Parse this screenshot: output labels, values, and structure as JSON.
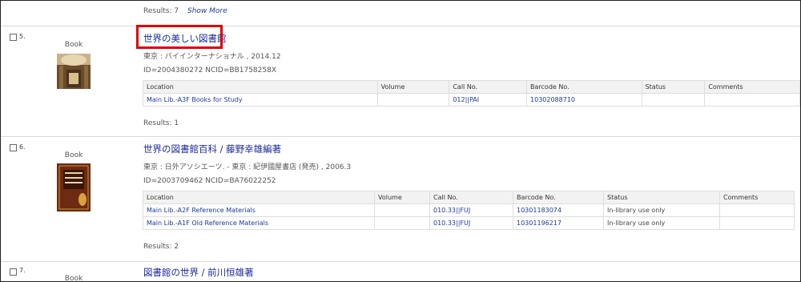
{
  "top": {
    "results": "Results: 7",
    "show_more": "Show More"
  },
  "records": [
    {
      "num": "5.",
      "type": "Book",
      "title": "世界の美しい図書館",
      "pub": "東京 : パイインターナショナル , 2014.12",
      "ids": "ID=2004380272 NCID=BB1758258X",
      "headers": [
        "Location",
        "Volume",
        "Call No.",
        "Barcode No.",
        "Status",
        "Comments"
      ],
      "rows": [
        {
          "location": "Main Lib.-A3F Books for Study",
          "volume": "",
          "call": "012||PAI",
          "barcode": "10302088710",
          "status": "",
          "comments": ""
        }
      ],
      "results": "Results: 1"
    },
    {
      "num": "6.",
      "type": "Book",
      "title": "世界の図書館百科 / 藤野幸雄編著",
      "pub": "東京 : 日外アソシエーツ. - 東京 : 紀伊國屋書店 (発売) , 2006.3",
      "ids": "ID=2003709462 NCID=BA76022252",
      "headers": [
        "Location",
        "Volume",
        "Call No.",
        "Barcode No.",
        "Status",
        "Comments"
      ],
      "rows": [
        {
          "location": "Main Lib.-A2F Reference Materials",
          "volume": "",
          "call": "010.33||FUJ",
          "barcode": "10301183074",
          "status": "In-library use only",
          "comments": ""
        },
        {
          "location": "Main Lib.-A1F Old Reference Materials",
          "volume": "",
          "call": "010.33||FUJ",
          "barcode": "10301196217",
          "status": "In-library use only",
          "comments": ""
        }
      ],
      "results": "Results: 2"
    },
    {
      "num": "7.",
      "type": "Book",
      "title": "図書館の世界 / 前川恒雄著"
    }
  ]
}
